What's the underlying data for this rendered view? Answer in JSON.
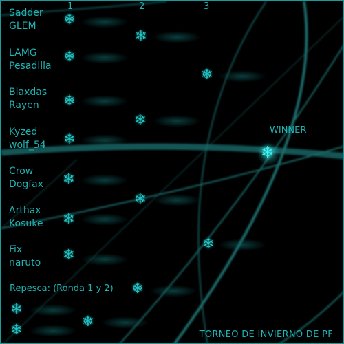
{
  "title": "TORNEO DE INVIERNO DE PF",
  "rounds": [
    "1",
    "2",
    "3"
  ],
  "winner_label": "WINNER",
  "repesca_label": "Repesca: (Ronda 1 y 2)",
  "matches": [
    {
      "p1": "Sadder",
      "p2": "GLEM"
    },
    {
      "p1": "LAMG",
      "p2": "Pesadilla"
    },
    {
      "p1": "Blaxdas",
      "p2": "Rayen"
    },
    {
      "p1": "Kyzed",
      "p2": "wolf_54"
    },
    {
      "p1": "Crow",
      "p2": "Dogfax"
    },
    {
      "p1": "Arthax",
      "p2": "Kosuke"
    },
    {
      "p1": "Fix",
      "p2": "naruto"
    }
  ],
  "icons": {
    "slot": "snowflake-icon",
    "glyph": "❄"
  },
  "colors": {
    "accent": "#1fb3b3",
    "border": "#1a9a9a",
    "background": "#000000",
    "glow": "#3ff0f0"
  }
}
